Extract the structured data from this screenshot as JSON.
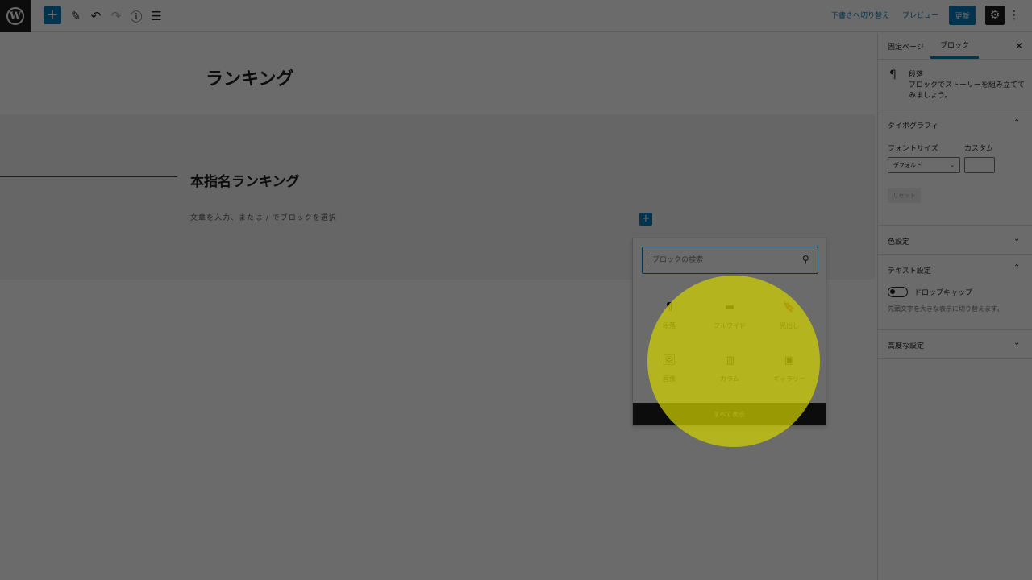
{
  "toolbar": {
    "logo_glyph": "W",
    "add_glyph": "+",
    "edit_glyph": "✎",
    "undo_glyph": "↶",
    "redo_glyph": "↷",
    "info_glyph": "ⓘ",
    "outline_glyph": "☰",
    "switch_draft": "下書きへ切り替え",
    "preview": "プレビュー",
    "update": "更新",
    "settings_glyph": "⚙",
    "more_glyph": "⋮"
  },
  "editor": {
    "page_title": "ランキング",
    "section_heading": "本指名ランキング",
    "paragraph_placeholder": "文章を入力、または / でブロックを選択",
    "inline_add_glyph": "+"
  },
  "inserter": {
    "search_placeholder": "ブロックの検索",
    "search_glyph": "⚲",
    "blocks": [
      {
        "label": "段落",
        "icon": "¶"
      },
      {
        "label": "フルワイド",
        "icon": "▬"
      },
      {
        "label": "見出し",
        "icon": "🔖"
      },
      {
        "label": "画像",
        "icon": "🖼"
      },
      {
        "label": "カラム",
        "icon": "▥"
      },
      {
        "label": "ギャラリー",
        "icon": "▣"
      }
    ],
    "show_all": "すべて表示"
  },
  "sidebar": {
    "tabs": [
      "固定ページ",
      "ブロック"
    ],
    "close_glyph": "✕",
    "block_icon": "¶",
    "block_name": "段落",
    "block_description": "ブロックでストーリーを組み立ててみましょう。",
    "typography": {
      "title": "タイポグラフィ",
      "font_size_label": "フォントサイズ",
      "custom_label": "カスタム",
      "select_value": "デフォルト",
      "reset": "リセット"
    },
    "color_settings": "色設定",
    "text_settings": {
      "title": "テキスト設定",
      "drop_cap": "ドロップキャップ",
      "help": "先頭文字を大きな表示に切り替えます。"
    },
    "advanced": "高度な設定",
    "chevron_up": "⌃",
    "chevron_down": "⌄"
  },
  "colors": {
    "accent": "#007cba",
    "highlight": "#d0d000"
  }
}
